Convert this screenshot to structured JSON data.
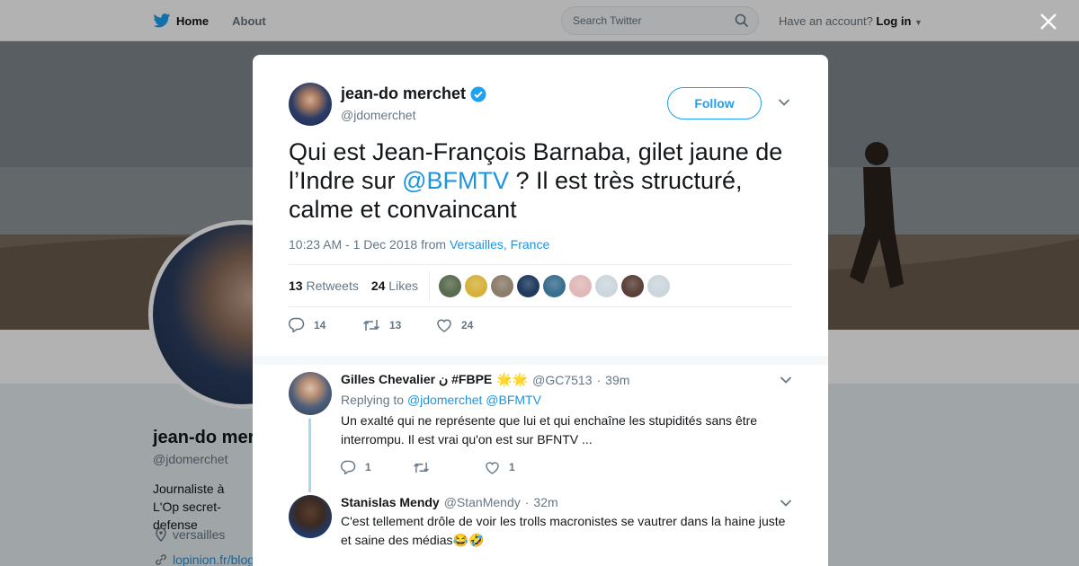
{
  "topbar": {
    "home_label": "Home",
    "about_label": "About",
    "search_placeholder": "Search Twitter",
    "account_text": "Have an account?",
    "login_label": "Log in"
  },
  "profile": {
    "name": "jean-do merchet",
    "handle": "@jdomerchet",
    "bio": "Journaliste à L'Op secret-defense",
    "location": "versailles",
    "link": "lopinion.fr/blog"
  },
  "tweet": {
    "author_name": "jean-do merchet",
    "author_handle": "@jdomerchet",
    "follow_label": "Follow",
    "text_before": "Qui est Jean-François Barnaba, gilet jaune de l’Indre sur ",
    "mention": "@BFMTV",
    "text_after": " ? Il est très structuré, calme et convaincant",
    "time": "10:23 AM - 1 Dec 2018 from ",
    "location": "Versailles, France",
    "retweets_count": "13",
    "retweets_label": "Retweets",
    "likes_count": "24",
    "likes_label": "Likes",
    "reply_count": "14",
    "retweet_count": "13",
    "like_count": "24",
    "liker_colors": [
      "#5a6b4e",
      "#d4b23c",
      "#8b7d6b",
      "#1e3a5f",
      "#3a6e8f",
      "#e0b8b8",
      "#ccd6dd",
      "#5a4038",
      "#ccd6dd"
    ]
  },
  "replies": [
    {
      "name": "Gilles Chevalier ن #FBPE",
      "emoji": "🌟🌟",
      "handle": "@GC7513",
      "time": "39m",
      "replying_prefix": "Replying to",
      "replying_to": "@jdomerchet @BFMTV",
      "text": "Un exalté qui ne représente que lui et qui enchaîne les stupidités sans être interrompu. Il est vrai qu'on est sur BFNTV ...",
      "reply_count": "1",
      "retweet_count": "",
      "like_count": "1",
      "avatar_color": "#5d6f86"
    },
    {
      "name": "Stanislas Mendy",
      "handle": "@StanMendy",
      "time": "32m",
      "text": "C'est tellement drôle de voir les trolls macronistes se vautrer dans la haine juste et saine des médias😂🤣",
      "avatar_color": "#3b2a22"
    }
  ],
  "colors": {
    "accent": "#1da1f2",
    "link": "#1b95e0",
    "verified": "#1da1f2"
  }
}
